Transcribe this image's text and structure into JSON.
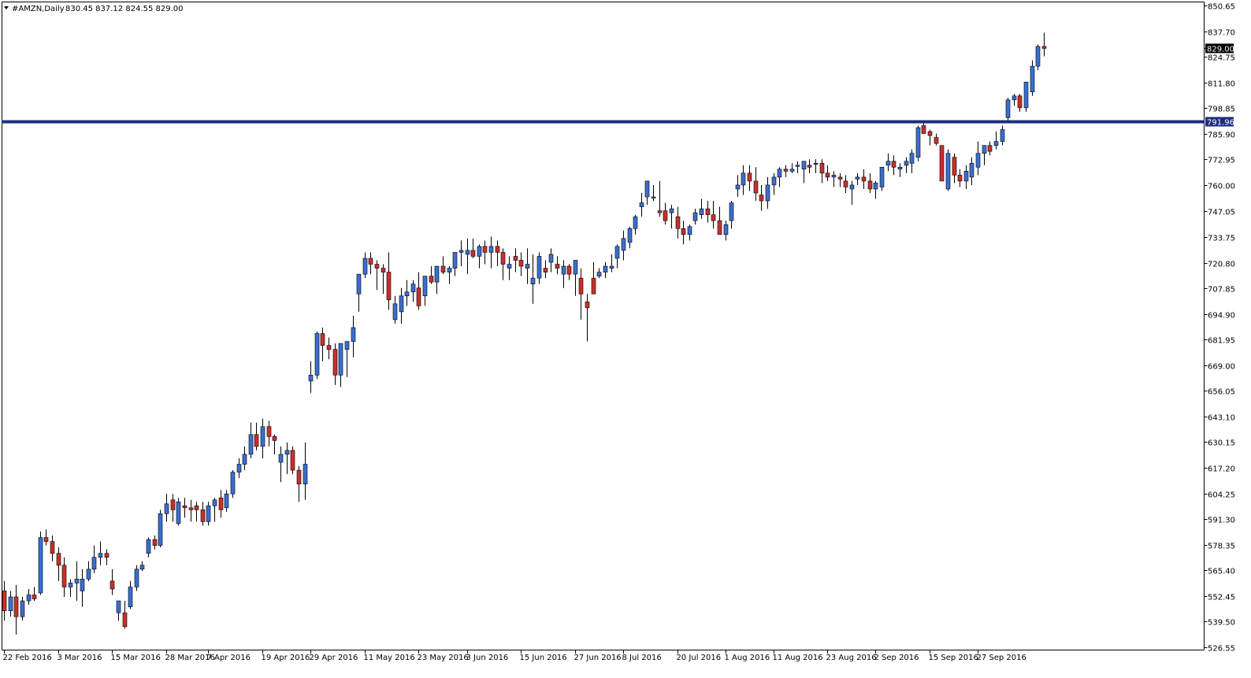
{
  "header": {
    "symbol": "#AMZN,Daily",
    "ohlc": "830.45 837.12 824.55 829.00"
  },
  "colors": {
    "bull": "#3a6fd0",
    "bear": "#c8302c",
    "wick": "#000000",
    "hline": "#1f2e7a",
    "price_tag_bg": "#000000",
    "price_tag_fg": "#ffffff"
  },
  "chart_data": {
    "type": "candlestick",
    "ylim": [
      526.55,
      850.65
    ],
    "yticks": [
      "850.65",
      "837.70",
      "824.75",
      "811.80",
      "798.85",
      "785.90",
      "772.95",
      "760.00",
      "747.05",
      "733.75",
      "720.80",
      "707.85",
      "694.90",
      "681.95",
      "669.00",
      "656.05",
      "643.10",
      "630.15",
      "617.20",
      "604.25",
      "591.30",
      "578.35",
      "565.40",
      "552.45",
      "539.50",
      "526.55"
    ],
    "xlabels": [
      "22 Feb 2016",
      "3 Mar 2016",
      "15 Mar 2016",
      "28 Mar 2016",
      "7 Apr 2016",
      "19 Apr 2016",
      "29 Apr 2016",
      "11 May 2016",
      "23 May 2016",
      "3 Jun 2016",
      "15 Jun 2016",
      "27 Jun 2016",
      "8 Jul 2016",
      "20 Jul 2016",
      "1 Aug 2016",
      "11 Aug 2016",
      "23 Aug 2016",
      "2 Sep 2016",
      "15 Sep 2016",
      "27 Sep 2016"
    ],
    "xlabel_index": [
      0,
      9,
      18,
      27,
      34,
      43,
      51,
      60,
      69,
      77,
      86,
      95,
      103,
      112,
      120,
      128,
      137,
      145,
      154,
      162
    ],
    "horizontal_line": {
      "value": 791.96,
      "label": "791.96"
    },
    "last_price": {
      "value": 829.0,
      "label": "829.00"
    },
    "candles": [
      [
        555,
        560,
        540,
        545
      ],
      [
        545,
        555,
        542,
        552
      ],
      [
        552,
        558,
        533,
        542
      ],
      [
        542,
        552,
        540,
        550
      ],
      [
        550,
        556,
        548,
        553
      ],
      [
        553,
        557,
        550,
        551
      ],
      [
        554,
        585,
        553,
        582
      ],
      [
        582,
        586,
        578,
        580
      ],
      [
        580,
        583,
        570,
        574
      ],
      [
        574,
        577,
        560,
        568
      ],
      [
        568,
        572,
        552,
        557
      ],
      [
        557,
        561,
        552,
        559
      ],
      [
        559,
        570,
        550,
        561
      ],
      [
        555,
        566,
        547,
        561
      ],
      [
        561,
        570,
        560,
        566
      ],
      [
        566,
        578,
        564,
        572
      ],
      [
        572,
        580,
        568,
        574
      ],
      [
        574,
        576,
        568,
        572
      ],
      [
        560,
        566,
        553,
        556
      ],
      [
        544,
        548,
        540,
        550
      ],
      [
        544,
        550,
        536,
        537
      ],
      [
        547,
        560,
        546,
        557
      ],
      [
        557,
        568,
        555,
        566
      ],
      [
        566,
        570,
        565,
        568
      ],
      [
        574,
        582,
        572,
        581
      ],
      [
        581,
        583,
        576,
        578
      ],
      [
        578,
        596,
        577,
        594
      ],
      [
        594,
        604,
        590,
        599
      ],
      [
        601,
        604,
        590,
        596
      ],
      [
        589,
        602,
        588,
        600
      ],
      [
        598,
        602,
        592,
        597
      ],
      [
        597,
        601,
        590,
        596
      ],
      [
        598,
        600,
        590,
        596
      ],
      [
        596,
        600,
        588,
        590
      ],
      [
        590,
        600,
        588,
        598
      ],
      [
        598,
        602,
        590,
        601
      ],
      [
        602,
        606,
        592,
        596
      ],
      [
        597,
        606,
        595,
        604
      ],
      [
        604,
        616,
        602,
        615
      ],
      [
        615,
        622,
        612,
        619
      ],
      [
        619,
        628,
        616,
        624
      ],
      [
        624,
        640,
        622,
        634
      ],
      [
        634,
        640,
        626,
        628
      ],
      [
        628,
        642,
        622,
        638
      ],
      [
        638,
        641,
        628,
        633
      ],
      [
        633,
        634,
        624,
        631
      ],
      [
        620,
        628,
        610,
        624
      ],
      [
        624,
        630,
        614,
        626
      ],
      [
        626,
        628,
        614,
        616
      ],
      [
        616,
        618,
        600,
        609
      ],
      [
        609,
        630,
        601,
        619
      ],
      [
        661,
        671,
        655,
        664
      ],
      [
        664,
        686,
        662,
        685
      ],
      [
        685,
        688,
        671,
        679
      ],
      [
        679,
        683,
        672,
        677
      ],
      [
        677,
        680,
        659,
        664
      ],
      [
        664,
        679,
        658,
        680
      ],
      [
        677,
        681,
        663,
        681
      ],
      [
        681,
        694,
        673,
        688
      ],
      [
        705,
        713,
        696,
        715
      ],
      [
        715,
        726,
        713,
        723
      ],
      [
        723,
        726,
        715,
        720
      ],
      [
        720,
        722,
        707,
        718
      ],
      [
        718,
        720,
        705,
        716
      ],
      [
        716,
        726,
        697,
        702
      ],
      [
        692,
        704,
        690,
        700
      ],
      [
        696,
        708,
        690,
        704
      ],
      [
        704,
        712,
        699,
        706
      ],
      [
        706,
        712,
        701,
        710
      ],
      [
        708,
        716,
        697,
        699
      ],
      [
        704,
        714,
        699,
        714
      ],
      [
        714,
        719,
        710,
        711
      ],
      [
        711,
        716,
        705,
        719
      ],
      [
        719,
        724,
        715,
        716
      ],
      [
        716,
        719,
        710,
        718
      ],
      [
        718,
        726,
        714,
        726
      ],
      [
        726,
        732,
        719,
        727
      ],
      [
        725,
        733,
        715,
        727
      ],
      [
        727,
        733,
        723,
        724
      ],
      [
        724,
        730,
        718,
        729
      ],
      [
        729,
        732,
        720,
        726
      ],
      [
        726,
        734,
        718,
        729
      ],
      [
        729,
        732,
        719,
        726
      ],
      [
        726,
        728,
        712,
        720
      ],
      [
        718,
        724,
        712,
        720
      ],
      [
        724,
        728,
        716,
        722
      ],
      [
        722,
        726,
        714,
        719
      ],
      [
        718,
        728,
        710,
        720
      ],
      [
        710,
        725,
        700,
        713
      ],
      [
        713,
        726,
        710,
        724
      ],
      [
        718,
        722,
        713,
        716
      ],
      [
        721,
        728,
        716,
        725
      ],
      [
        720,
        724,
        715,
        718
      ],
      [
        715,
        722,
        708,
        719
      ],
      [
        719,
        720,
        712,
        715
      ],
      [
        715,
        722,
        704,
        722
      ],
      [
        713,
        718,
        692,
        705
      ],
      [
        701,
        705,
        681,
        698
      ],
      [
        713,
        721,
        705,
        705
      ],
      [
        714,
        718,
        713,
        716
      ],
      [
        716,
        721,
        713,
        719
      ],
      [
        718,
        725,
        716,
        719
      ],
      [
        723,
        730,
        718,
        729
      ],
      [
        727,
        737,
        722,
        733
      ],
      [
        731,
        739,
        728,
        738
      ],
      [
        738,
        745,
        735,
        744
      ],
      [
        749,
        756,
        744,
        751
      ],
      [
        754,
        762,
        750,
        762
      ],
      [
        754,
        760,
        752,
        754
      ],
      [
        747,
        762,
        744,
        746
      ],
      [
        747,
        751,
        740,
        742
      ],
      [
        746,
        750,
        738,
        748
      ],
      [
        744,
        749,
        733,
        738
      ],
      [
        738,
        742,
        730,
        735
      ],
      [
        735,
        740,
        732,
        739
      ],
      [
        742,
        748,
        740,
        746
      ],
      [
        745,
        753,
        743,
        748
      ],
      [
        748,
        752,
        741,
        745
      ],
      [
        745,
        752,
        738,
        742
      ],
      [
        742,
        749,
        735,
        735
      ],
      [
        735,
        742,
        732,
        740
      ],
      [
        742,
        752,
        738,
        751
      ],
      [
        758,
        765,
        754,
        760
      ],
      [
        760,
        770,
        755,
        766
      ],
      [
        766,
        770,
        757,
        762
      ],
      [
        762,
        769,
        752,
        756
      ],
      [
        755,
        760,
        747,
        752
      ],
      [
        752,
        764,
        748,
        760
      ],
      [
        760,
        766,
        755,
        764
      ],
      [
        764,
        769,
        759,
        768
      ],
      [
        768,
        770,
        764,
        767
      ],
      [
        767,
        771,
        766,
        768
      ],
      [
        770,
        772,
        766,
        770
      ],
      [
        768,
        772,
        761,
        772
      ],
      [
        770,
        773,
        766,
        769
      ],
      [
        771,
        773,
        766,
        771
      ],
      [
        771,
        773,
        761,
        766
      ],
      [
        766,
        770,
        762,
        764
      ],
      [
        764,
        767,
        759,
        765
      ],
      [
        764,
        766,
        759,
        763
      ],
      [
        762,
        765,
        756,
        759
      ],
      [
        758,
        762,
        750,
        760
      ],
      [
        763,
        766,
        760,
        764
      ],
      [
        764,
        768,
        758,
        762
      ],
      [
        762,
        766,
        756,
        758
      ],
      [
        758,
        762,
        753,
        761
      ],
      [
        759,
        768,
        757,
        769
      ],
      [
        770,
        776,
        767,
        772
      ],
      [
        772,
        775,
        765,
        769
      ],
      [
        768,
        771,
        764,
        769
      ],
      [
        770,
        774,
        766,
        772
      ],
      [
        771,
        778,
        766,
        776
      ],
      [
        774,
        790,
        772,
        789
      ],
      [
        790,
        792,
        786,
        786
      ],
      [
        787,
        788,
        780,
        785
      ],
      [
        784,
        786,
        780,
        781
      ],
      [
        780,
        780,
        762,
        762
      ],
      [
        758,
        778,
        757,
        776
      ],
      [
        774,
        776,
        761,
        765
      ],
      [
        765,
        768,
        759,
        762
      ],
      [
        762,
        770,
        758,
        767
      ],
      [
        764,
        774,
        760,
        771
      ],
      [
        769,
        782,
        765,
        776
      ],
      [
        776,
        780,
        770,
        780
      ],
      [
        780,
        782,
        775,
        777
      ],
      [
        780,
        787,
        778,
        782
      ],
      [
        782,
        790,
        780,
        788
      ],
      [
        794,
        804,
        792,
        803
      ],
      [
        803,
        806,
        800,
        805
      ],
      [
        805,
        806,
        797,
        799
      ],
      [
        799,
        811,
        797,
        812
      ],
      [
        807,
        823,
        805,
        820
      ],
      [
        820,
        831,
        818,
        830
      ],
      [
        830,
        837,
        825,
        829
      ]
    ]
  }
}
